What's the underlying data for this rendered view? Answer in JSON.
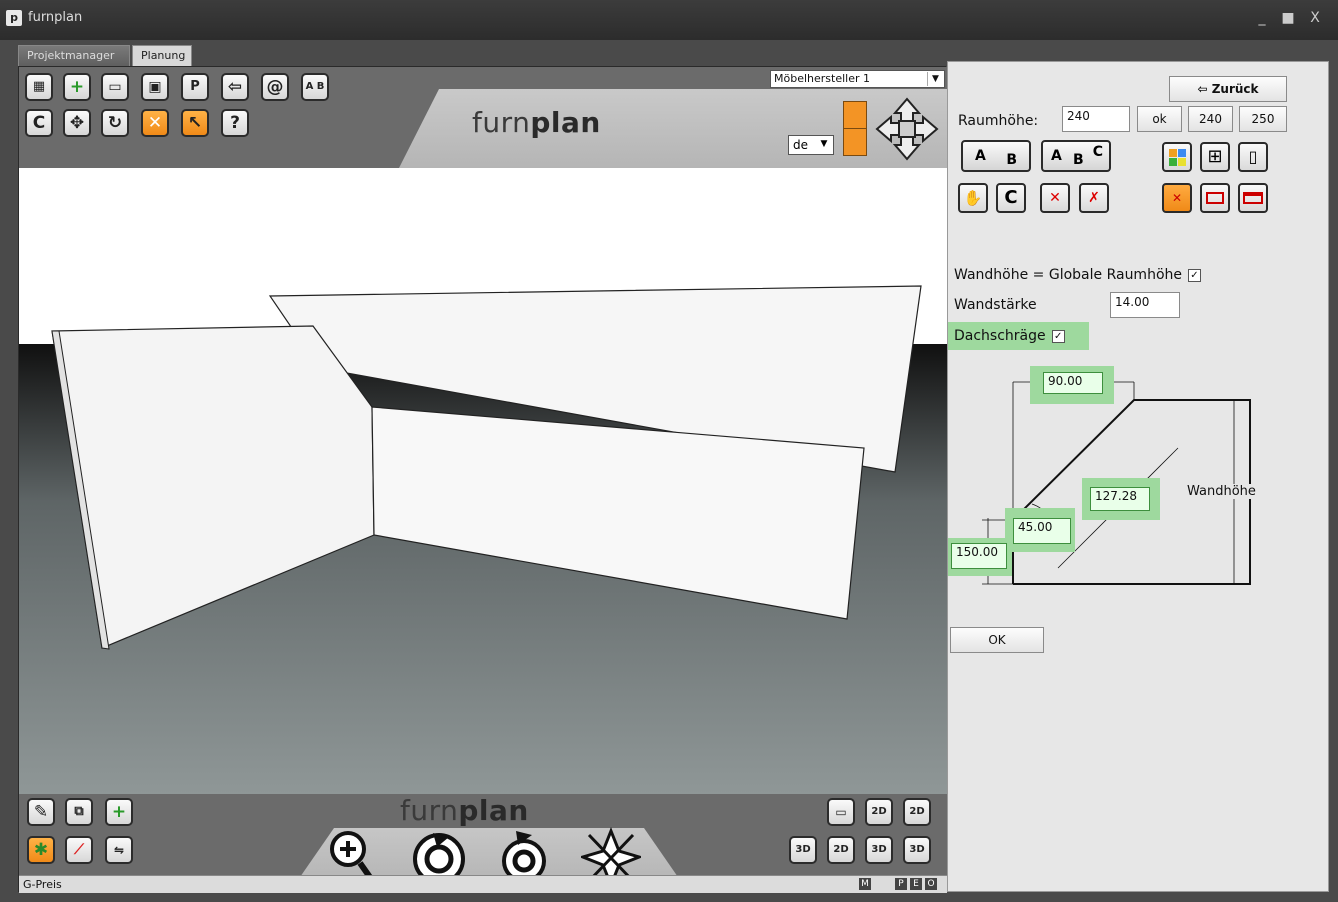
{
  "window": {
    "title": "furnplan",
    "controls": [
      "_",
      "■",
      "X"
    ]
  },
  "tabs": [
    {
      "label": "Projektmanager"
    },
    {
      "label": "Planung"
    }
  ],
  "toolbar": {
    "manufacturer_select": "Möbelhersteller 1",
    "language_select": "de",
    "brand_left": "furn",
    "brand_right": "plan"
  },
  "status": {
    "label": "G-Preis",
    "flags": [
      "M",
      "P",
      "E",
      "O"
    ]
  },
  "panel": {
    "back_button": "⇦ Zurück",
    "room_height_label": "Raumhöhe:",
    "room_height_value": "240",
    "ok_small": "ok",
    "preset_240": "240",
    "preset_250": "250",
    "wall_height_global_label": "Wandhöhe = Globale Raumhöhe",
    "wall_thickness_label": "Wandstärke",
    "wall_thickness_value": "14.00",
    "slope_label": "Dachschräge",
    "ok_button": "OK",
    "diagram": {
      "top_width": "90.00",
      "slope_length": "127.28",
      "angle": "45.00",
      "bottom_height": "150.00",
      "wall_height_label": "Wandhöhe"
    }
  },
  "colors": {
    "accent_orange": "#f39425",
    "highlight_green": "#9ed99e"
  },
  "icons": {
    "top_row1": [
      "floorplan-icon",
      "new-icon",
      "folder-icon",
      "save-icon",
      "print-icon",
      "back-arrow-icon",
      "email-icon",
      "ab-icon"
    ],
    "top_row2": [
      "c-icon",
      "move-icon",
      "rotate-icon",
      "delete-icon",
      "pointer-icon",
      "help-icon"
    ]
  }
}
